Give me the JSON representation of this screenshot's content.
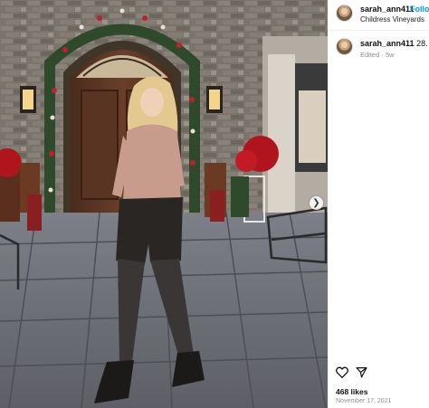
{
  "post": {
    "username": "sarah_ann411",
    "follow_label": "Follow",
    "location": "Childress Vineyards",
    "caption_number": "28.",
    "edited_label": "Edited",
    "time_ago": "5w",
    "likes": "468 likes",
    "date": "November 17, 2021",
    "photo_description_icon": "photo-icon"
  },
  "icons": {
    "like": "heart-icon",
    "share": "send-icon",
    "next": "chevron-right-icon"
  }
}
